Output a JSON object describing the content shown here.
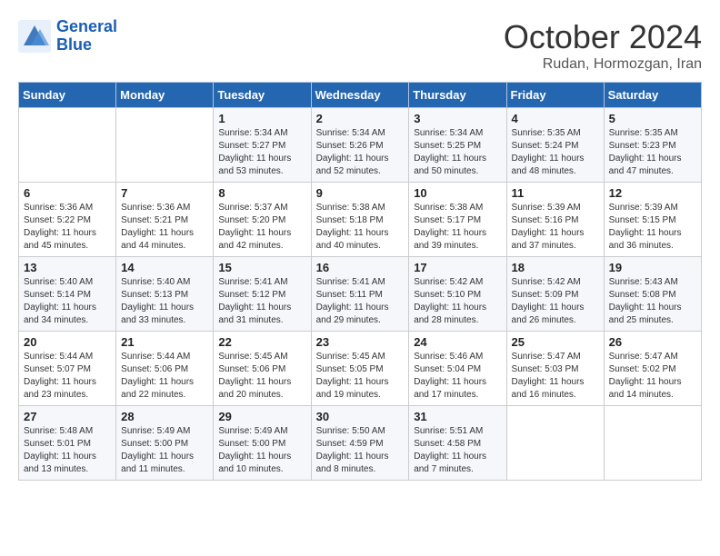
{
  "header": {
    "logo_line1": "General",
    "logo_line2": "Blue",
    "month": "October 2024",
    "location": "Rudan, Hormozgan, Iran"
  },
  "weekdays": [
    "Sunday",
    "Monday",
    "Tuesday",
    "Wednesday",
    "Thursday",
    "Friday",
    "Saturday"
  ],
  "weeks": [
    [
      {
        "day": "",
        "info": ""
      },
      {
        "day": "",
        "info": ""
      },
      {
        "day": "1",
        "info": "Sunrise: 5:34 AM\nSunset: 5:27 PM\nDaylight: 11 hours\nand 53 minutes."
      },
      {
        "day": "2",
        "info": "Sunrise: 5:34 AM\nSunset: 5:26 PM\nDaylight: 11 hours\nand 52 minutes."
      },
      {
        "day": "3",
        "info": "Sunrise: 5:34 AM\nSunset: 5:25 PM\nDaylight: 11 hours\nand 50 minutes."
      },
      {
        "day": "4",
        "info": "Sunrise: 5:35 AM\nSunset: 5:24 PM\nDaylight: 11 hours\nand 48 minutes."
      },
      {
        "day": "5",
        "info": "Sunrise: 5:35 AM\nSunset: 5:23 PM\nDaylight: 11 hours\nand 47 minutes."
      }
    ],
    [
      {
        "day": "6",
        "info": "Sunrise: 5:36 AM\nSunset: 5:22 PM\nDaylight: 11 hours\nand 45 minutes."
      },
      {
        "day": "7",
        "info": "Sunrise: 5:36 AM\nSunset: 5:21 PM\nDaylight: 11 hours\nand 44 minutes."
      },
      {
        "day": "8",
        "info": "Sunrise: 5:37 AM\nSunset: 5:20 PM\nDaylight: 11 hours\nand 42 minutes."
      },
      {
        "day": "9",
        "info": "Sunrise: 5:38 AM\nSunset: 5:18 PM\nDaylight: 11 hours\nand 40 minutes."
      },
      {
        "day": "10",
        "info": "Sunrise: 5:38 AM\nSunset: 5:17 PM\nDaylight: 11 hours\nand 39 minutes."
      },
      {
        "day": "11",
        "info": "Sunrise: 5:39 AM\nSunset: 5:16 PM\nDaylight: 11 hours\nand 37 minutes."
      },
      {
        "day": "12",
        "info": "Sunrise: 5:39 AM\nSunset: 5:15 PM\nDaylight: 11 hours\nand 36 minutes."
      }
    ],
    [
      {
        "day": "13",
        "info": "Sunrise: 5:40 AM\nSunset: 5:14 PM\nDaylight: 11 hours\nand 34 minutes."
      },
      {
        "day": "14",
        "info": "Sunrise: 5:40 AM\nSunset: 5:13 PM\nDaylight: 11 hours\nand 33 minutes."
      },
      {
        "day": "15",
        "info": "Sunrise: 5:41 AM\nSunset: 5:12 PM\nDaylight: 11 hours\nand 31 minutes."
      },
      {
        "day": "16",
        "info": "Sunrise: 5:41 AM\nSunset: 5:11 PM\nDaylight: 11 hours\nand 29 minutes."
      },
      {
        "day": "17",
        "info": "Sunrise: 5:42 AM\nSunset: 5:10 PM\nDaylight: 11 hours\nand 28 minutes."
      },
      {
        "day": "18",
        "info": "Sunrise: 5:42 AM\nSunset: 5:09 PM\nDaylight: 11 hours\nand 26 minutes."
      },
      {
        "day": "19",
        "info": "Sunrise: 5:43 AM\nSunset: 5:08 PM\nDaylight: 11 hours\nand 25 minutes."
      }
    ],
    [
      {
        "day": "20",
        "info": "Sunrise: 5:44 AM\nSunset: 5:07 PM\nDaylight: 11 hours\nand 23 minutes."
      },
      {
        "day": "21",
        "info": "Sunrise: 5:44 AM\nSunset: 5:06 PM\nDaylight: 11 hours\nand 22 minutes."
      },
      {
        "day": "22",
        "info": "Sunrise: 5:45 AM\nSunset: 5:06 PM\nDaylight: 11 hours\nand 20 minutes."
      },
      {
        "day": "23",
        "info": "Sunrise: 5:45 AM\nSunset: 5:05 PM\nDaylight: 11 hours\nand 19 minutes."
      },
      {
        "day": "24",
        "info": "Sunrise: 5:46 AM\nSunset: 5:04 PM\nDaylight: 11 hours\nand 17 minutes."
      },
      {
        "day": "25",
        "info": "Sunrise: 5:47 AM\nSunset: 5:03 PM\nDaylight: 11 hours\nand 16 minutes."
      },
      {
        "day": "26",
        "info": "Sunrise: 5:47 AM\nSunset: 5:02 PM\nDaylight: 11 hours\nand 14 minutes."
      }
    ],
    [
      {
        "day": "27",
        "info": "Sunrise: 5:48 AM\nSunset: 5:01 PM\nDaylight: 11 hours\nand 13 minutes."
      },
      {
        "day": "28",
        "info": "Sunrise: 5:49 AM\nSunset: 5:00 PM\nDaylight: 11 hours\nand 11 minutes."
      },
      {
        "day": "29",
        "info": "Sunrise: 5:49 AM\nSunset: 5:00 PM\nDaylight: 11 hours\nand 10 minutes."
      },
      {
        "day": "30",
        "info": "Sunrise: 5:50 AM\nSunset: 4:59 PM\nDaylight: 11 hours\nand 8 minutes."
      },
      {
        "day": "31",
        "info": "Sunrise: 5:51 AM\nSunset: 4:58 PM\nDaylight: 11 hours\nand 7 minutes."
      },
      {
        "day": "",
        "info": ""
      },
      {
        "day": "",
        "info": ""
      }
    ]
  ]
}
